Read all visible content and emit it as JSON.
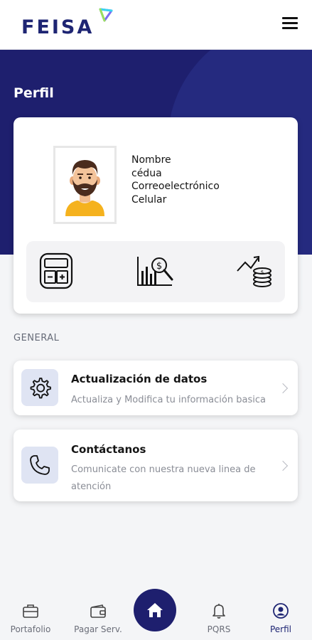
{
  "header": {
    "logo_text": "FEISA",
    "logo_mark_colors": [
      "#3ad4f0",
      "#7b6cf0",
      "#9be15d"
    ],
    "menu_icon": "hamburger-menu-icon"
  },
  "page": {
    "title": "Perfil",
    "hero_color": "#1e1f6e"
  },
  "profile": {
    "avatar_icon": "user-avatar-icon",
    "fields": [
      "Nombre",
      "cédua",
      "Correoelectrónico",
      "Celular"
    ],
    "actions": [
      {
        "icon": "calculator-icon"
      },
      {
        "icon": "financial-analysis-icon"
      },
      {
        "icon": "investment-growth-icon"
      }
    ]
  },
  "general": {
    "section_label": "GENERAL",
    "items": [
      {
        "icon": "gear-icon",
        "title": "Actualización de datos",
        "description": "Actualiza y Modifica tu información basica"
      },
      {
        "icon": "phone-icon",
        "title": "Contáctanos",
        "description_lines": [
          "Comunicate con nuestra nueva linea de",
          "atención"
        ]
      }
    ]
  },
  "bottom_nav": {
    "items": [
      {
        "label": "Portafolio",
        "icon": "briefcase-icon"
      },
      {
        "label": "Pagar Serv.",
        "icon": "wallet-icon"
      },
      {
        "label": "PQRS",
        "icon": "bell-icon"
      },
      {
        "label": "Perfil",
        "icon": "user-circle-icon"
      }
    ],
    "home_icon": "home-icon",
    "active": "Perfil"
  }
}
